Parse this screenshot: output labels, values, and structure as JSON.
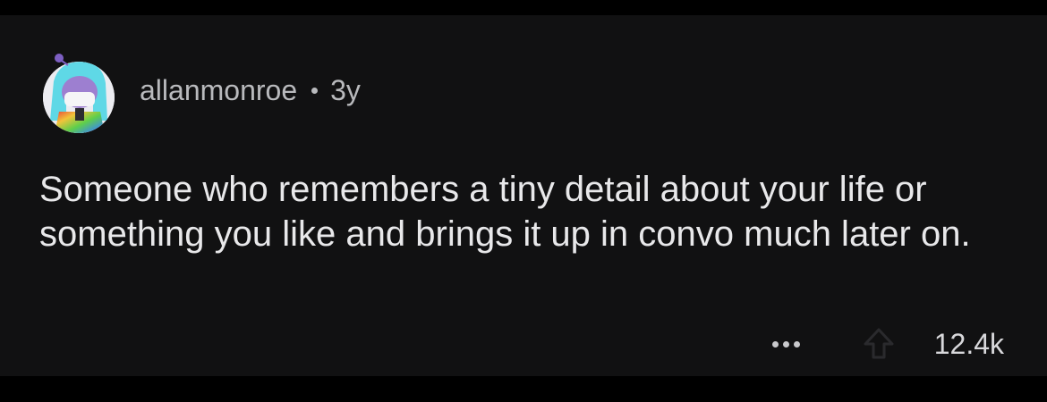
{
  "comment": {
    "username": "allanmonroe",
    "separator": "•",
    "age": "3y",
    "body": "Someone who remembers a tiny detail about your life or something you like and brings it up in convo much later on.",
    "score": "12.4k"
  },
  "icons": {
    "avatar": "avatar-character-icon",
    "more": "more-options-icon",
    "upvote": "upvote-arrow-icon"
  },
  "colors": {
    "background": "#000000",
    "card": "#111112",
    "meta_text": "#b9babd",
    "body_text": "#e8e8ea"
  }
}
